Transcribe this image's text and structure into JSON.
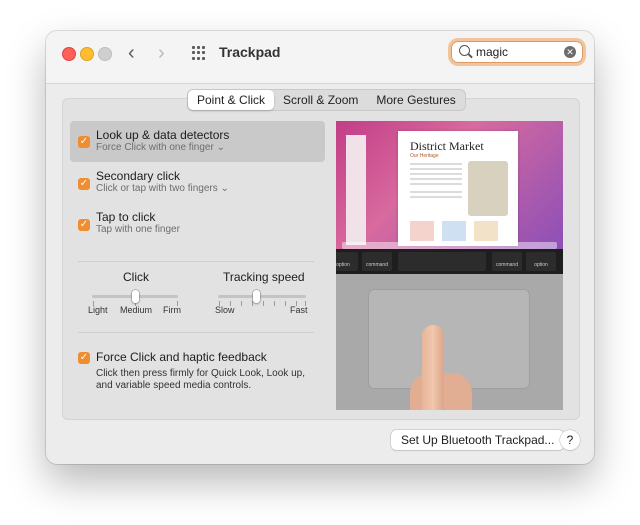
{
  "window": {
    "title": "Trackpad"
  },
  "search": {
    "value": "magic"
  },
  "tabs": [
    {
      "label": "Point & Click",
      "active": true
    },
    {
      "label": "Scroll & Zoom",
      "active": false
    },
    {
      "label": "More Gestures",
      "active": false
    }
  ],
  "options": [
    {
      "title": "Look up & data detectors",
      "subtitle": "Force Click with one finger",
      "checked": true,
      "has_menu": true
    },
    {
      "title": "Secondary click",
      "subtitle": "Click or tap with two fingers",
      "checked": true,
      "has_menu": true
    },
    {
      "title": "Tap to click",
      "subtitle": "Tap with one finger",
      "checked": true,
      "has_menu": false
    }
  ],
  "sliders": {
    "click": {
      "label": "Click",
      "min_label": "Light",
      "mid_label": "Medium",
      "max_label": "Firm",
      "value": "Medium"
    },
    "tracking": {
      "label": "Tracking speed",
      "min_label": "Slow",
      "max_label": "Fast"
    }
  },
  "force_click": {
    "title": "Force Click and haptic feedback",
    "description_lines": [
      "Click then press firmly for Quick Look, Look up,",
      "and variable speed media controls."
    ],
    "checked": true
  },
  "preview": {
    "doc_title": "District Market",
    "doc_subtitle": "Our Heritage",
    "keys": [
      "option",
      "command",
      "command",
      "option"
    ]
  },
  "footer": {
    "bluetooth_button": "Set Up Bluetooth Trackpad...",
    "help": "?"
  },
  "colors": {
    "accent": "#ef8d32",
    "search_focus": "#f3c49a"
  }
}
